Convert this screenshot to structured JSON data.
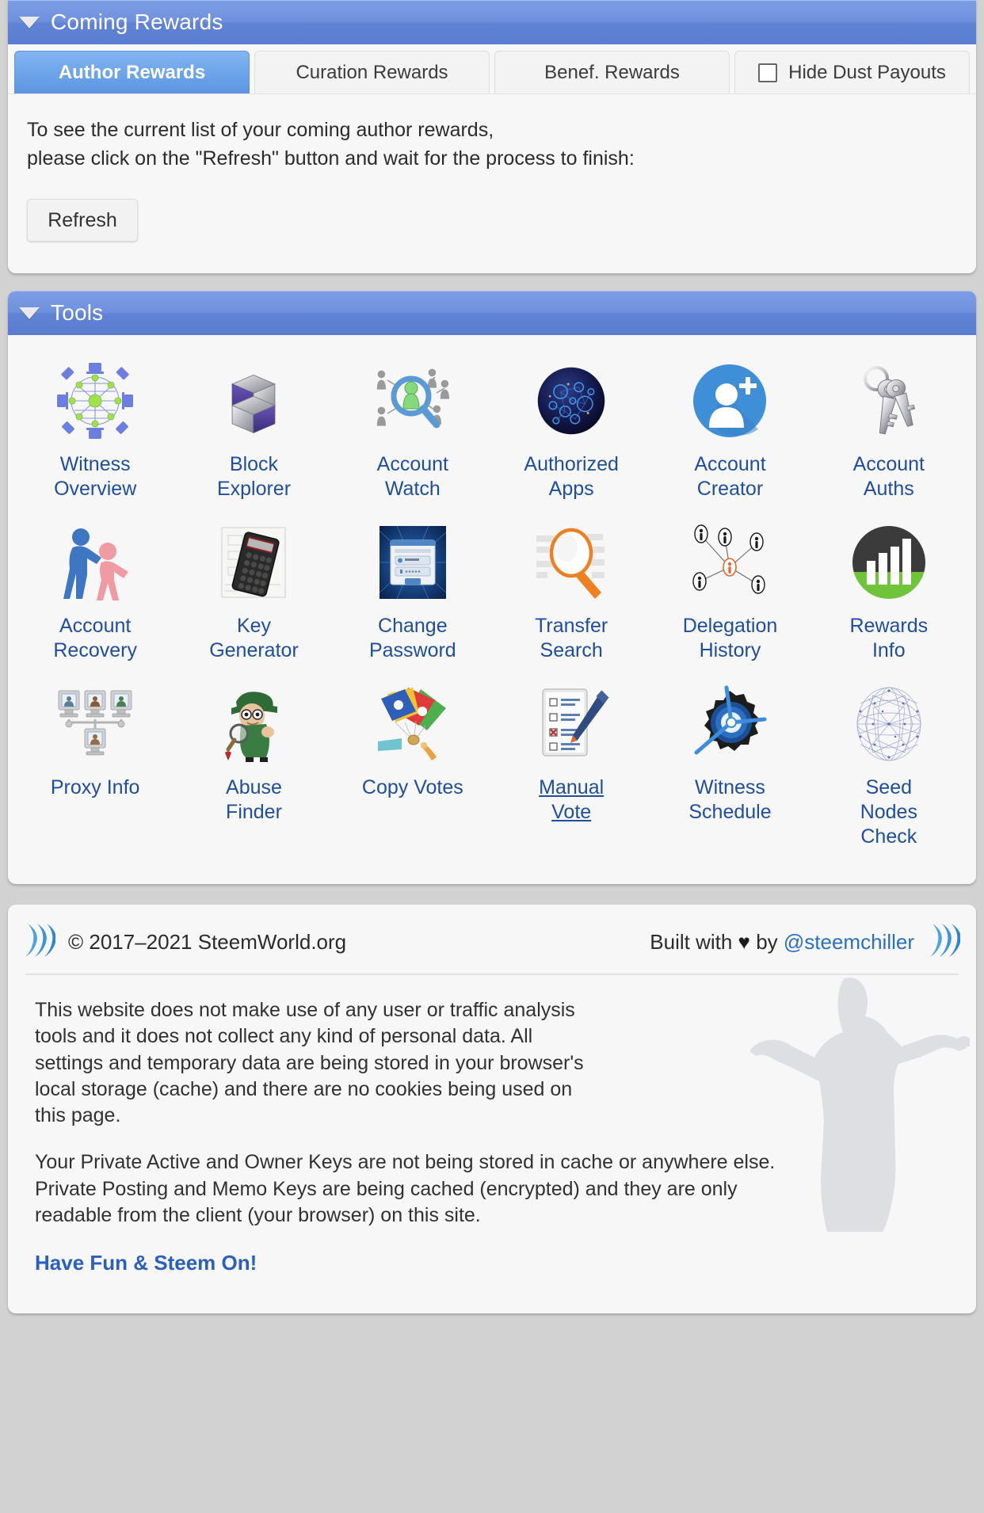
{
  "coming_rewards": {
    "header_title": "Coming Rewards",
    "collapse_icon": "triangle-down-icon",
    "tabs": [
      {
        "label": "Author Rewards",
        "active": true,
        "checkbox": false
      },
      {
        "label": "Curation Rewards",
        "active": false,
        "checkbox": false
      },
      {
        "label": "Benef. Rewards",
        "active": false,
        "checkbox": false
      },
      {
        "label": "Hide Dust Payouts",
        "active": false,
        "checkbox": true,
        "checked": false
      }
    ],
    "body": {
      "line1": "To see the current list of your coming author rewards,",
      "line2": "please click on the \"Refresh\" button and wait for the process to finish:",
      "refresh_label": "Refresh"
    }
  },
  "tools": {
    "header_title": "Tools",
    "collapse_icon": "triangle-down-icon",
    "items": [
      {
        "label": "Witness\nOverview",
        "line1": "Witness",
        "line2": "Overview",
        "icon": "network-mesh-icon",
        "hovered": false
      },
      {
        "label": "Block\nExplorer",
        "line1": "Block",
        "line2": "Explorer",
        "icon": "blocks-cube-icon",
        "hovered": false
      },
      {
        "label": "Account\nWatch",
        "line1": "Account",
        "line2": "Watch",
        "icon": "people-magnifier-icon",
        "hovered": false
      },
      {
        "label": "Authorized\nApps",
        "line1": "Authorized",
        "line2": "Apps",
        "icon": "globe-network-icon",
        "hovered": false
      },
      {
        "label": "Account\nCreator",
        "line1": "Account",
        "line2": "Creator",
        "icon": "user-plus-circle-icon",
        "hovered": false
      },
      {
        "label": "Account\nAuths",
        "line1": "Account",
        "line2": "Auths",
        "icon": "keys-icon",
        "hovered": false
      },
      {
        "label": "Account\nRecovery",
        "line1": "Account",
        "line2": "Recovery",
        "icon": "helping-hands-icon",
        "hovered": false
      },
      {
        "label": "Key\nGenerator",
        "line1": "Key",
        "line2": "Generator",
        "icon": "calculator-icon",
        "hovered": false
      },
      {
        "label": "Change\nPassword",
        "line1": "Change",
        "line2": "Password",
        "icon": "login-form-icon",
        "hovered": false
      },
      {
        "label": "Transfer\nSearch",
        "line1": "Transfer",
        "line2": "Search",
        "icon": "magnifier-docs-icon",
        "hovered": false
      },
      {
        "label": "Delegation\nHistory",
        "line1": "Delegation",
        "line2": "History",
        "icon": "delegation-graph-icon",
        "hovered": false
      },
      {
        "label": "Rewards\nInfo",
        "line1": "Rewards",
        "line2": "Info",
        "icon": "bar-chart-circle-icon",
        "hovered": false
      },
      {
        "label": "Proxy Info",
        "line1": "Proxy Info",
        "line2": "",
        "icon": "proxy-screens-icon",
        "hovered": false
      },
      {
        "label": "Abuse\nFinder",
        "line1": "Abuse",
        "line2": "Finder",
        "icon": "detective-icon",
        "hovered": false
      },
      {
        "label": "Copy Votes",
        "line1": "Copy Votes",
        "line2": "",
        "icon": "vote-cards-icon",
        "hovered": false
      },
      {
        "label": "Manual\nVote",
        "line1": "Manual",
        "line2": "Vote",
        "icon": "checklist-pen-icon",
        "hovered": true
      },
      {
        "label": "Witness\nSchedule",
        "line1": "Witness",
        "line2": "Schedule",
        "icon": "gear-compass-icon",
        "hovered": false
      },
      {
        "label": "Seed Nodes\nCheck",
        "line1": "Seed",
        "line2": "Nodes",
        "line3": "Check",
        "icon": "wire-globe-icon",
        "hovered": false
      }
    ]
  },
  "footer": {
    "logo_icon": "steem-logo-icon",
    "copyright": "© 2017–2021 SteemWorld.org",
    "built_prefix": "Built with ",
    "built_heart": "♥",
    "built_mid": " by ",
    "built_author": "@steemchiller",
    "paragraph1": "This website does not make use of any user or traffic analysis tools and it does not collect any kind of personal data. All settings and temporary data are being stored in your browser's local storage (cache) and there are no cookies being used on this page.",
    "paragraph2": "Your Private Active and Owner Keys are not being stored in cache or anywhere else. Private Posting and Memo Keys are being cached (encrypted) and they are only readable from the client (your browser) on this site.",
    "sign_off": "Have Fun & Steem On!",
    "silhouette_icon": "person-arms-open-silhouette-icon"
  },
  "colors": {
    "panel_header_blue": "#6183d4",
    "tab_active_blue": "#6ba4ea",
    "link_blue": "#1f4e9c",
    "page_background": "#d2d2d2",
    "panel_background": "#f7f7f7",
    "sign_off_blue": "#2a5fbf"
  }
}
